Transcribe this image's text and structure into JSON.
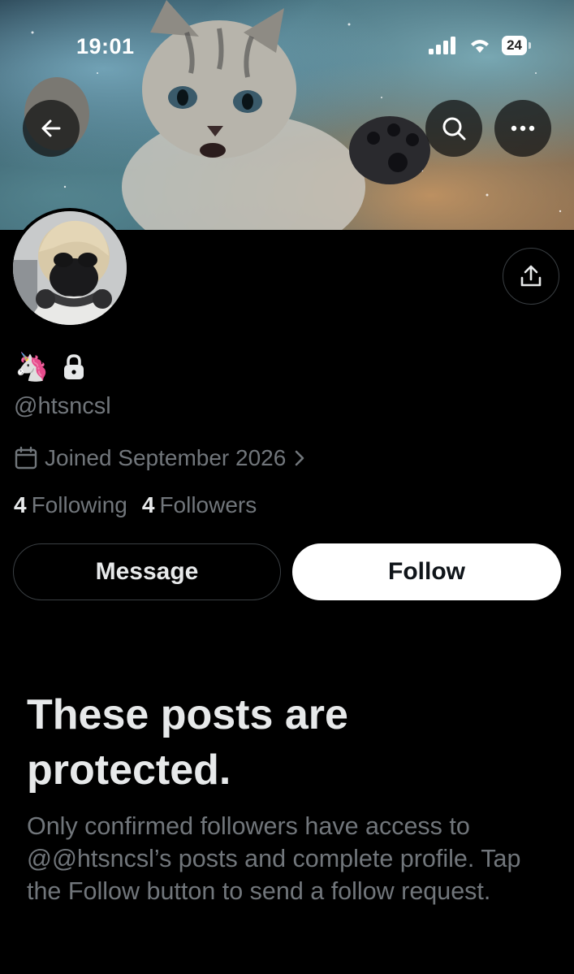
{
  "status_bar": {
    "time": "19:01",
    "battery": "24",
    "icons": [
      "signal-icon",
      "wifi-icon",
      "battery-icon"
    ]
  },
  "banner": {
    "description_icon": "kitten-banner-image"
  },
  "header_buttons": {
    "back": "back-arrow-icon",
    "search": "search-icon",
    "more": "more-icon"
  },
  "profile": {
    "name_emoji": "🦄",
    "locked_icon": "lock-icon",
    "handle": "@htsncsl",
    "joined": "Joined September 2026",
    "following_count": "4",
    "following_label": "Following",
    "followers_count": "4",
    "followers_label": "Followers"
  },
  "actions": {
    "message_label": "Message",
    "follow_label": "Follow"
  },
  "protected": {
    "title": "These posts are protected.",
    "body": "Only confirmed followers have access to @@htsncsl’s posts and complete profile. Tap the Follow button to send a follow request."
  },
  "colors": {
    "background": "#000000",
    "primary_text": "#e7e9ea",
    "secondary_text": "#71767b",
    "border": "#3a3f43",
    "follow_button_bg": "#ffffff"
  }
}
